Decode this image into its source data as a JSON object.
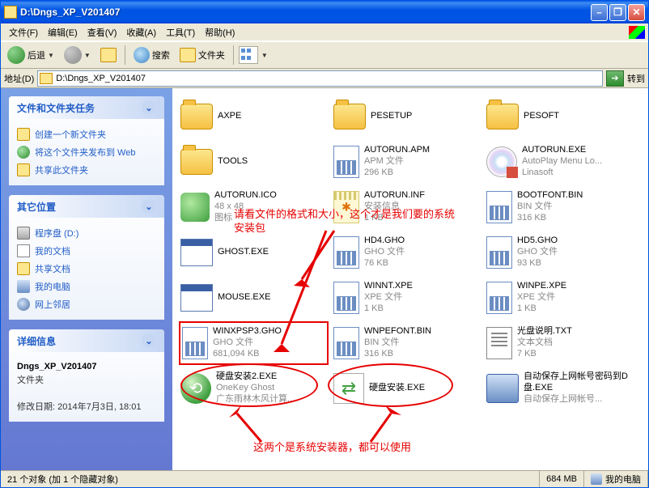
{
  "window": {
    "title": "D:\\Dngs_XP_V201407"
  },
  "menus": {
    "file": "文件(F)",
    "edit": "编辑(E)",
    "view": "查看(V)",
    "favorites": "收藏(A)",
    "tools": "工具(T)",
    "help": "帮助(H)"
  },
  "toolbar": {
    "back": "后退",
    "search": "搜索",
    "folders": "文件夹"
  },
  "address": {
    "label": "地址(D)",
    "value": "D:\\Dngs_XP_V201407",
    "go": "转到"
  },
  "sidebar": {
    "tasks_title": "文件和文件夹任务",
    "tasks": [
      {
        "icon": "folder",
        "label": "创建一个新文件夹"
      },
      {
        "icon": "globe",
        "label": "将这个文件夹发布到 Web"
      },
      {
        "icon": "folder",
        "label": "共享此文件夹"
      }
    ],
    "other_title": "其它位置",
    "other": [
      {
        "icon": "disk",
        "label": "程序盘 (D:)"
      },
      {
        "icon": "doc",
        "label": "我的文档"
      },
      {
        "icon": "folder",
        "label": "共享文档"
      },
      {
        "icon": "pc",
        "label": "我的电脑"
      },
      {
        "icon": "net",
        "label": "网上邻居"
      }
    ],
    "details_title": "详细信息",
    "details": {
      "name": "Dngs_XP_V201407",
      "type": "文件夹",
      "modified_label": "修改日期:",
      "modified": "2014年7月3日, 18:01"
    }
  },
  "files": [
    {
      "icon": "folder-big",
      "name": "AXPE",
      "meta1": "",
      "meta2": ""
    },
    {
      "icon": "folder-big",
      "name": "PESETUP",
      "meta1": "",
      "meta2": ""
    },
    {
      "icon": "folder-big",
      "name": "PESOFT",
      "meta1": "",
      "meta2": ""
    },
    {
      "icon": "folder-big",
      "name": "TOOLS",
      "meta1": "",
      "meta2": ""
    },
    {
      "icon": "file-apm",
      "name": "AUTORUN.APM",
      "meta1": "APM 文件",
      "meta2": "296 KB"
    },
    {
      "icon": "file-cd",
      "name": "AUTORUN.EXE",
      "meta1": "AutoPlay Menu Lo...",
      "meta2": "Linasoft"
    },
    {
      "icon": "file-ico-green",
      "name": "AUTORUN.ICO",
      "meta1": "48 x 48",
      "meta2": "图标"
    },
    {
      "icon": "file-note",
      "name": "AUTORUN.INF",
      "meta1": "安装信息",
      "meta2": "1 KB"
    },
    {
      "icon": "file-apm",
      "name": "BOOTFONT.BIN",
      "meta1": "BIN 文件",
      "meta2": "316 KB"
    },
    {
      "icon": "file-exe",
      "name": "GHOST.EXE",
      "meta1": "",
      "meta2": ""
    },
    {
      "icon": "file-apm",
      "name": "HD4.GHO",
      "meta1": "GHO 文件",
      "meta2": "76 KB"
    },
    {
      "icon": "file-apm",
      "name": "HD5.GHO",
      "meta1": "GHO 文件",
      "meta2": "93 KB"
    },
    {
      "icon": "file-exe",
      "name": "MOUSE.EXE",
      "meta1": "",
      "meta2": ""
    },
    {
      "icon": "file-apm",
      "name": "WINNT.XPE",
      "meta1": "XPE 文件",
      "meta2": "1 KB"
    },
    {
      "icon": "file-apm",
      "name": "WINPE.XPE",
      "meta1": "XPE 文件",
      "meta2": "1 KB"
    },
    {
      "icon": "file-apm",
      "name": "WINXPSP3.GHO",
      "meta1": "GHO 文件",
      "meta2": "681,094 KB",
      "highlight": true
    },
    {
      "icon": "file-apm",
      "name": "WNPEFONT.BIN",
      "meta1": "BIN 文件",
      "meta2": "316 KB"
    },
    {
      "icon": "file-txt",
      "name": "光盘说明.TXT",
      "meta1": "文本文档",
      "meta2": "7 KB"
    },
    {
      "icon": "file-green-disc",
      "name": "硬盘安装2.EXE",
      "meta1": "OneKey Ghost",
      "meta2": "广东雨林木风计算..."
    },
    {
      "icon": "file-green-arrow",
      "name": "硬盘安装.EXE",
      "meta1": "",
      "meta2": ""
    },
    {
      "icon": "file-pc",
      "name": "自动保存上网帐号密码到D盘.EXE",
      "meta1": "自动保存上网帐号...",
      "meta2": ""
    }
  ],
  "annotations": {
    "a1": "请看文件的格式和大小，这个才是我们要的系统安装包",
    "a2": "这两个是系统安装器，都可以使用"
  },
  "status": {
    "count": "21 个对象 (加 1 个隐藏对象)",
    "size": "684 MB",
    "location": "我的电脑"
  }
}
